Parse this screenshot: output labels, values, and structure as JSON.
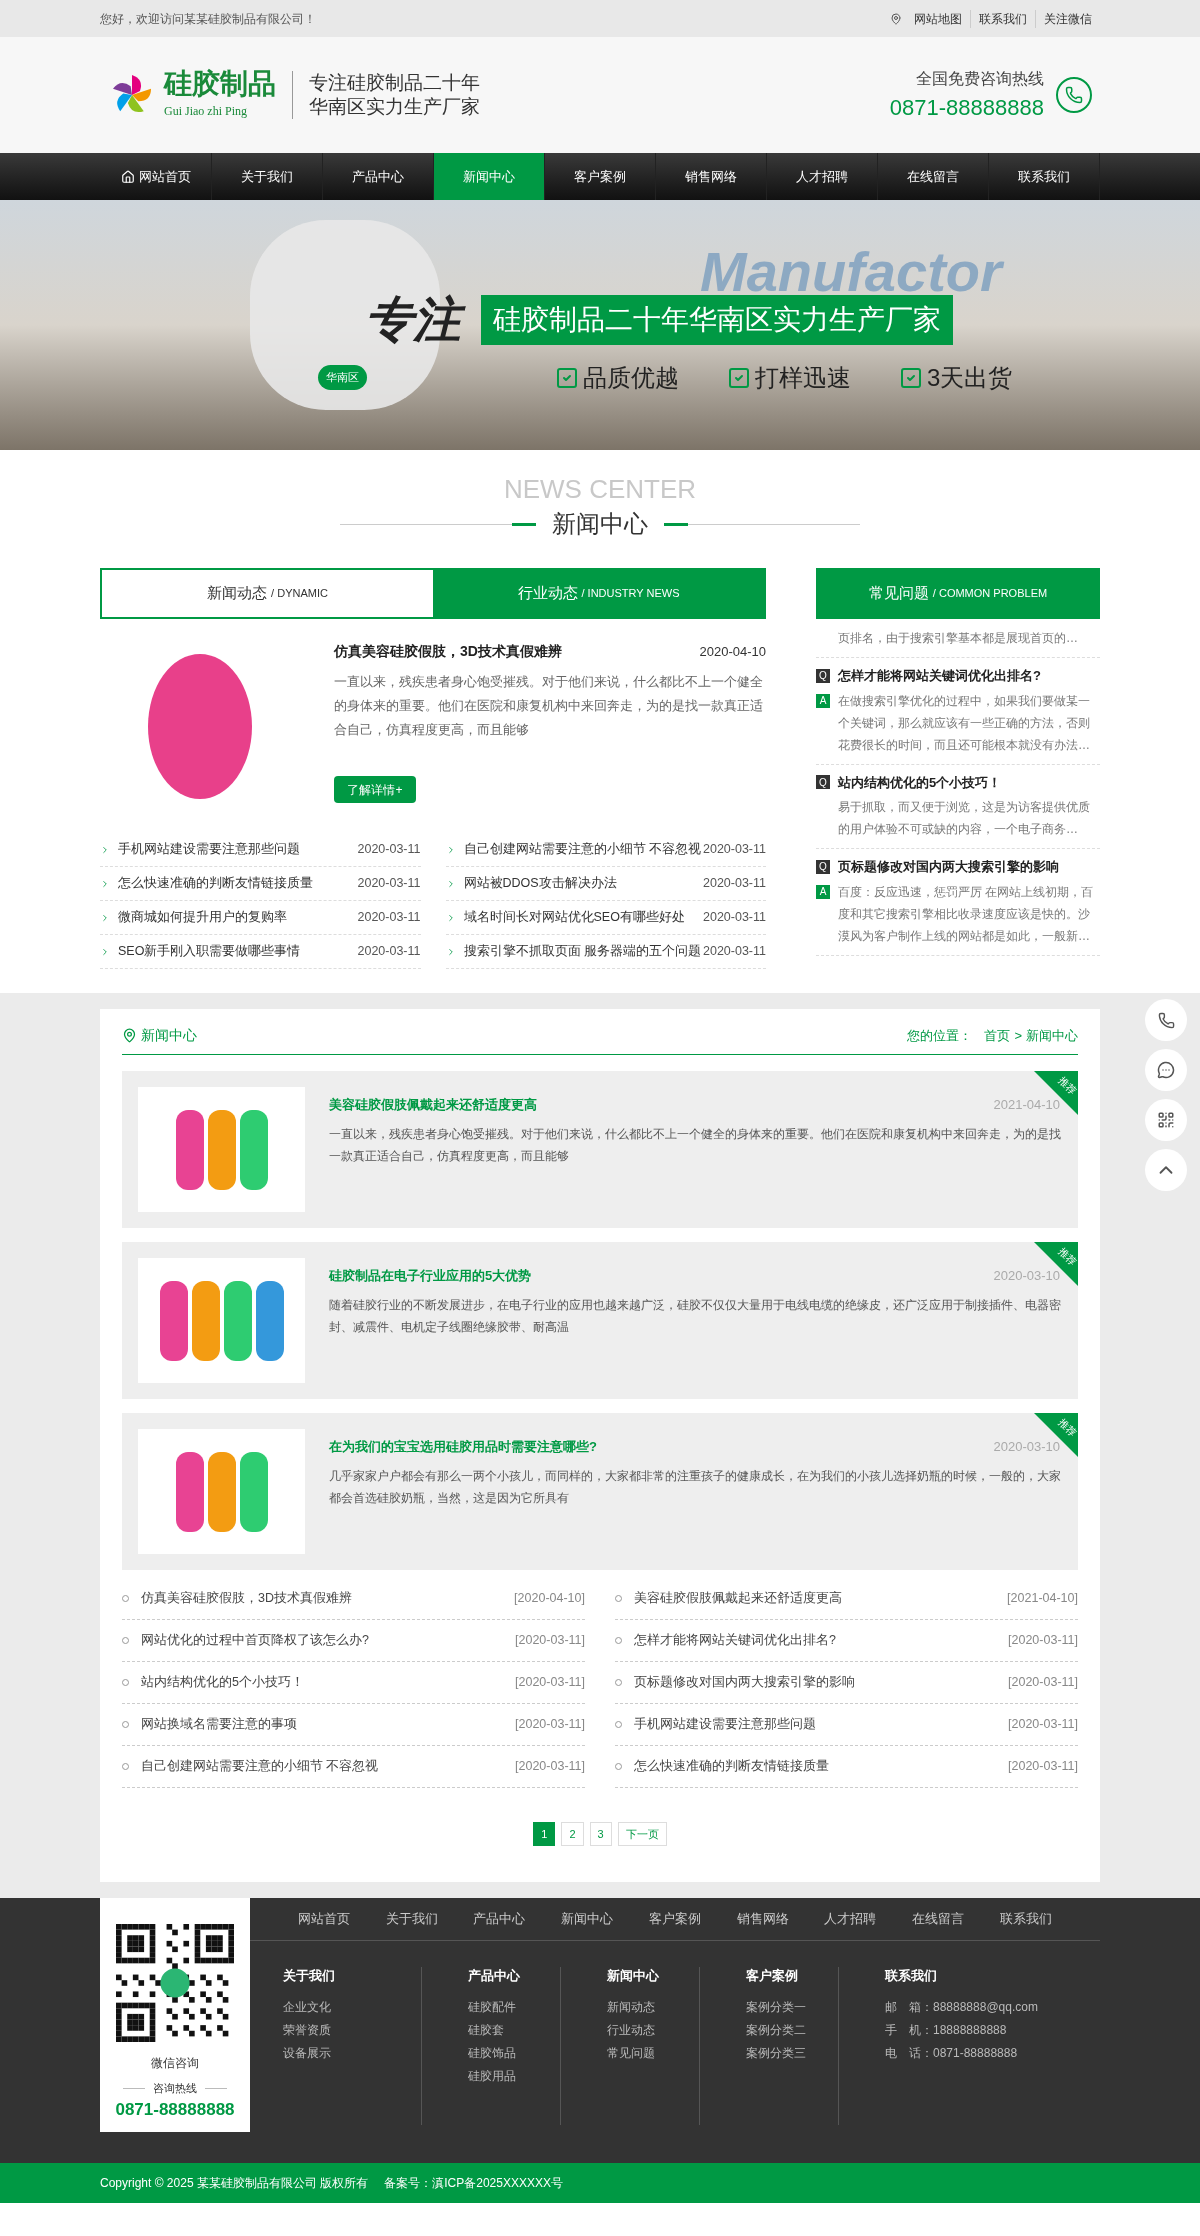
{
  "top_bar": {
    "greeting": "您好，欢迎访问某某硅胶制品有限公司！",
    "links": [
      "网站地图",
      "联系我们",
      "关注微信"
    ]
  },
  "header": {
    "logo_name": "硅胶制品",
    "logo_pinyin": "Gui Jiao zhi Ping",
    "slogan": [
      "专注硅胶制品二十年",
      "华南区实力生产厂家"
    ],
    "hotline_label": "全国免费咨询热线",
    "hotline": "0871-88888888"
  },
  "nav": [
    {
      "label": "网站首页",
      "selected": false
    },
    {
      "label": "关于我们",
      "selected": false
    },
    {
      "label": "产品中心",
      "selected": false
    },
    {
      "label": "新闻中心",
      "selected": true
    },
    {
      "label": "客户案例",
      "selected": false
    },
    {
      "label": "销售网络",
      "selected": false
    },
    {
      "label": "人才招聘",
      "selected": false
    },
    {
      "label": "在线留言",
      "selected": false
    },
    {
      "label": "联系我们",
      "selected": false
    }
  ],
  "banner": {
    "backdrop_word": "Manufactor",
    "lead": "专注",
    "headline": "硅胶制品二十年华南区实力生产厂家",
    "region": "华南区",
    "features": [
      "品质优越",
      "打样迅速",
      "3天出货"
    ]
  },
  "news_center": {
    "title_en": "NEWS CENTER",
    "title": "新闻中心",
    "tabs": [
      {
        "label": "新闻动态",
        "sub": "/ DYNAMIC",
        "selected": true
      },
      {
        "label": "行业动态",
        "sub": "/ INDUSTRY NEWS",
        "selected": false
      }
    ],
    "featured": {
      "title": "仿真美容硅胶假肢，3D技术真假难辨",
      "date": "2020-04-10",
      "summary": "一直以来，残疾患者身心饱受摧残。对于他们来说，什么都比不上一个健全的身体来的重要。他们在医院和康复机构中来回奔走，为的是找一款真正适合自己，仿真程度更高，而且能够",
      "button": "了解详情+"
    },
    "list": [
      {
        "title": "手机网站建设需要注意那些问题",
        "date": "2020-03-11"
      },
      {
        "title": "自己创建网站需要注意的小细节 不容忽视",
        "date": "2020-03-11"
      },
      {
        "title": "怎么快速准确的判断友情链接质量",
        "date": "2020-03-11"
      },
      {
        "title": "网站被DDOS攻击解决办法",
        "date": "2020-03-11"
      },
      {
        "title": "微商城如何提升用户的复购率",
        "date": "2020-03-11"
      },
      {
        "title": "域名时间长对网站优化SEO有哪些好处",
        "date": "2020-03-11"
      },
      {
        "title": "SEO新手刚入职需要做哪些事情",
        "date": "2020-03-11"
      },
      {
        "title": "搜索引擎不抓取页面 服务器端的五个问题",
        "date": "2020-03-11"
      }
    ]
  },
  "faq": {
    "title": "常见问题",
    "sub": "/ COMMON PROBLEM",
    "items": [
      {
        "answer": "页排名，由于搜索引擎基本都是展现首页的…"
      },
      {
        "q_mark": "Q",
        "question": "怎样才能将网站关键词优化出排名?",
        "a_mark": "A",
        "answer": "在做搜索引擎优化的过程中，如果我们要做某一个关键词，那么就应该有一些正确的方法，否则花费很长的时间，而且还可能根本就没有办法…"
      },
      {
        "q_mark": "Q",
        "question": "站内结构优化的5个小技巧！",
        "answer": "易于抓取，而又便于浏览，这是为访客提供优质的用户体验不可或缺的内容，一个电子商务…"
      },
      {
        "q_mark": "Q",
        "question": "页标题修改对国内两大搜索引擎的影响",
        "a_mark": "A",
        "answer": "百度：反应迅速，惩罚严厉 在网站上线初期，百度和其它搜索引擎相比收录速度应该是快的。沙漠风为客户制作上线的网站都是如此，一般新…"
      }
    ]
  },
  "articles": {
    "title": "新闻中心",
    "location_label": "您的位置：",
    "crumbs": [
      "首页",
      "新闻中心"
    ],
    "crumb_separator": ">",
    "cards": [
      {
        "title": "美容硅胶假肢佩戴起来还舒适度更高",
        "date": "2021-04-10",
        "tag": "推荐",
        "summary": "一直以来，残疾患者身心饱受摧残。对于他们来说，什么都比不上一个健全的身体来的重要。他们在医院和康复机构中来回奔走，为的是找一款真正适合自己，仿真程度更高，而且能够"
      },
      {
        "title": "硅胶制品在电子行业应用的5大优势",
        "date": "2020-03-10",
        "tag": "推荐",
        "summary": "随着硅胶行业的不断发展进步，在电子行业的应用也越来越广泛，硅胶不仅仅大量用于电线电缆的绝缘皮，还广泛应用于制接插件、电器密封、减震件、电机定子线圈绝缘胶带、耐高温"
      },
      {
        "title": "在为我们的宝宝选用硅胶用品时需要注意哪些?",
        "date": "2020-03-10",
        "tag": "推荐",
        "summary": "几乎家家户户都会有那么一两个小孩儿，而同样的，大家都非常的注重孩子的健康成长，在为我们的小孩儿选择奶瓶的时候，一般的，大家都会首选硅胶奶瓶，当然，这是因为它所具有"
      }
    ],
    "links": [
      {
        "title": "仿真美容硅胶假肢，3D技术真假难辨",
        "date": "[2020-04-10]"
      },
      {
        "title": "美容硅胶假肢佩戴起来还舒适度更高",
        "date": "[2021-04-10]"
      },
      {
        "title": "网站优化的过程中首页降权了该怎么办?",
        "date": "[2020-03-11]"
      },
      {
        "title": "怎样才能将网站关键词优化出排名?",
        "date": "[2020-03-11]"
      },
      {
        "title": "站内结构优化的5个小技巧！",
        "date": "[2020-03-11]"
      },
      {
        "title": "页标题修改对国内两大搜索引擎的影响",
        "date": "[2020-03-11]"
      },
      {
        "title": "网站换域名需要注意的事项",
        "date": "[2020-03-11]"
      },
      {
        "title": "手机网站建设需要注意那些问题",
        "date": "[2020-03-11]"
      },
      {
        "title": "自己创建网站需要注意的小细节 不容忽视",
        "date": "[2020-03-11]"
      },
      {
        "title": "怎么快速准确的判断友情链接质量",
        "date": "[2020-03-11]"
      }
    ],
    "pagination": [
      {
        "label": "1",
        "selected": true
      },
      {
        "label": "2",
        "selected": false
      },
      {
        "label": "3",
        "selected": false
      },
      {
        "label": "下一页",
        "selected": false
      }
    ]
  },
  "footer": {
    "qr_caption": "微信咨询",
    "hotline_label": "咨询热线",
    "hotline": "0871-88888888",
    "nav": [
      "网站首页",
      "关于我们",
      "产品中心",
      "新闻中心",
      "客户案例",
      "销售网络",
      "人才招聘",
      "在线留言",
      "联系我们"
    ],
    "columns": [
      {
        "heading": "关于我们",
        "items": [
          "企业文化",
          "荣誉资质",
          "设备展示"
        ]
      },
      {
        "heading": "产品中心",
        "items": [
          "硅胶配件",
          "硅胶套",
          "硅胶饰品",
          "硅胶用品"
        ]
      },
      {
        "heading": "新闻中心",
        "items": [
          "新闻动态",
          "行业动态",
          "常见问题"
        ]
      },
      {
        "heading": "客户案例",
        "items": [
          "案例分类一",
          "案例分类二",
          "案例分类三"
        ]
      }
    ],
    "contact": {
      "heading": "联系我们",
      "lines": [
        "邮　箱：88888888@qq.com",
        "手　机：18888888888",
        "电　话：0871-88888888"
      ]
    },
    "copyright": "Copyright © 2025 某某硅胶制品有限公司 版权所有",
    "icp": "备案号：滇ICP备2025XXXXXX号"
  }
}
